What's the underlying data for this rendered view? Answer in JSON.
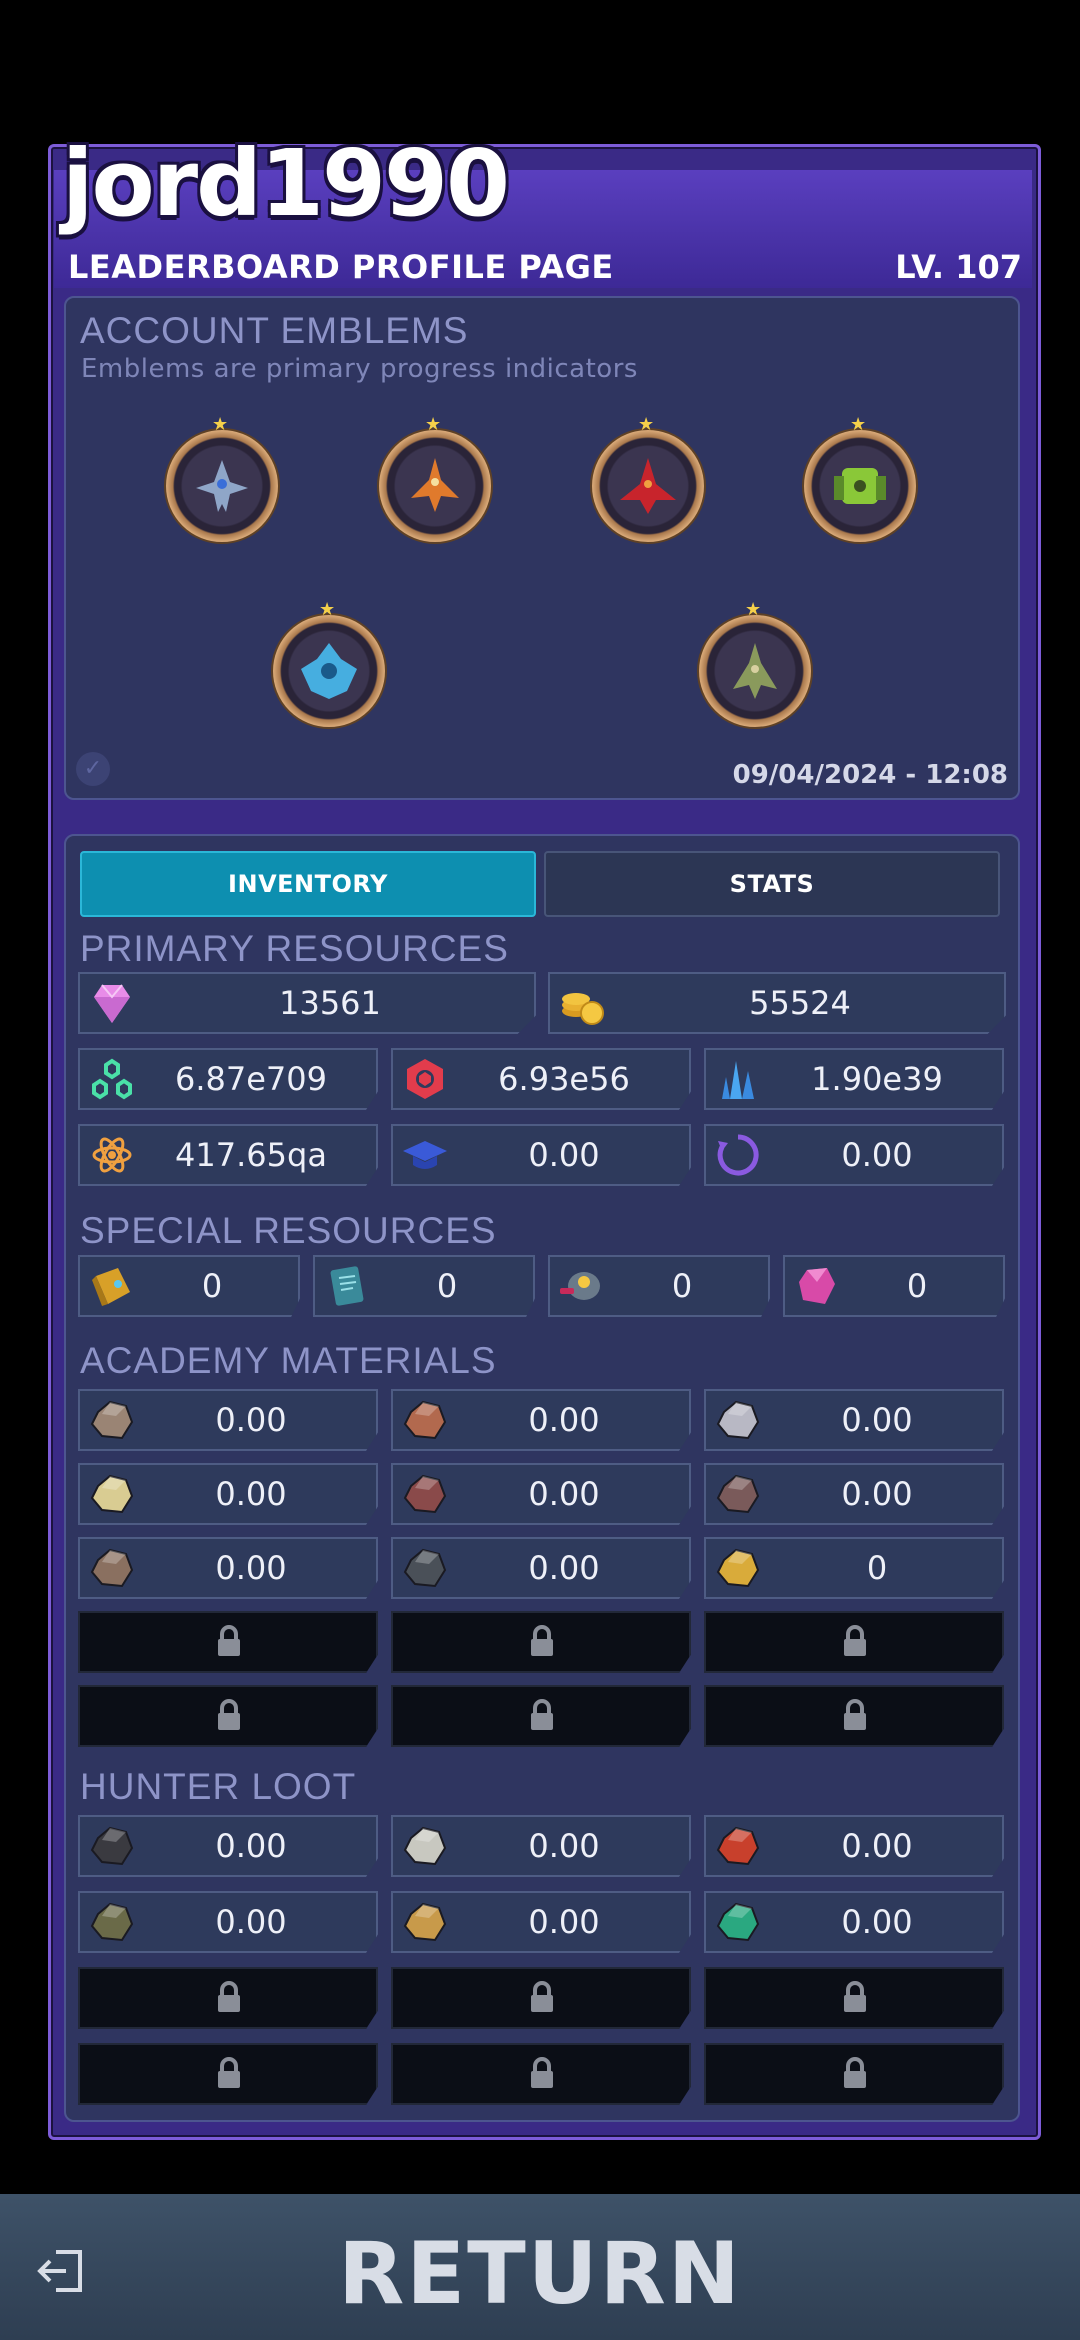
{
  "profile": {
    "username": "jord1990",
    "subtitle": "LEADERBOARD PROFILE PAGE",
    "level": "LV. 107"
  },
  "emblems": {
    "title": "ACCOUNT EMBLEMS",
    "subtitle": "Emblems are primary progress indicators",
    "timestamp": "09/04/2024 - 12:08",
    "items": [
      {
        "icon": "gray-fighter-ship-icon",
        "color": "#8fa6c8"
      },
      {
        "icon": "orange-fighter-ship-icon",
        "color": "#e07a2c"
      },
      {
        "icon": "red-fighter-ship-icon",
        "color": "#c8242c"
      },
      {
        "icon": "green-tank-ship-icon",
        "color": "#8ac838"
      },
      {
        "icon": "blue-cruiser-ship-icon",
        "color": "#46aee0"
      },
      {
        "icon": "olive-fighter-ship-icon",
        "color": "#8a9a5c"
      }
    ]
  },
  "tabs": {
    "inventory": "INVENTORY",
    "stats": "STATS"
  },
  "primary": {
    "title": "PRIMARY RESOURCES",
    "gems": "13561",
    "coins": "55524",
    "row2": [
      "6.87e709",
      "6.93e56",
      "1.90e39"
    ],
    "row3": [
      "417.65qa",
      "0.00",
      "0.00"
    ],
    "icons": [
      "gem-icon",
      "coins-icon",
      "molecule-icon",
      "hexagon-core-icon",
      "crystal-cluster-icon",
      "atom-icon",
      "graduation-cap-icon",
      "cycle-icon"
    ]
  },
  "special": {
    "title": "SPECIAL RESOURCES",
    "values": [
      "0",
      "0",
      "0",
      "0"
    ],
    "icons": [
      "gold-chip-icon",
      "blueprint-scroll-icon",
      "drone-icon",
      "pink-crystal-icon"
    ]
  },
  "academy": {
    "title": "ACADEMY MATERIALS",
    "values": [
      "0.00",
      "0.00",
      "0.00",
      "0.00",
      "0.00",
      "0.00",
      "0.00",
      "0.00",
      "0"
    ],
    "ore_colors": [
      "#9a8474",
      "#b2694e",
      "#b8b8c4",
      "#d9cc92",
      "#8a4a4a",
      "#7a5a5a",
      "#8a7060",
      "#4a5058",
      "#d9ab3a"
    ]
  },
  "hunter": {
    "title": "HUNTER LOOT",
    "values": [
      "0.00",
      "0.00",
      "0.00",
      "0.00",
      "0.00",
      "0.00"
    ],
    "ore_colors": [
      "#3a3a40",
      "#c8c8c0",
      "#c8402c",
      "#6a6a48",
      "#c89a4a",
      "#2aa880"
    ]
  },
  "footer": {
    "return_label": "RETURN"
  },
  "colors": {
    "accent_purple": "#7d5cd8",
    "tab_active": "#0d8fb0",
    "panel": "#2f3560"
  }
}
